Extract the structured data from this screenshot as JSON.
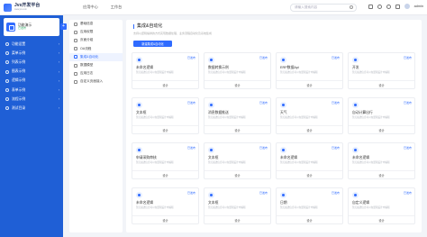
{
  "header": {
    "logo_title": "Jvs开发平台",
    "logo_sub": "www.jvs.com",
    "nav": [
      "应用中心",
      "工作台"
    ],
    "search_placeholder": "请输入搜索内容",
    "user": "admin"
  },
  "sidebar": {
    "app": {
      "name": "功能演示",
      "tag": "已发布"
    },
    "add_label": "+",
    "items": [
      {
        "label": "功能设置"
      },
      {
        "label": "菜单示例"
      },
      {
        "label": "列表示例"
      },
      {
        "label": "图表示例"
      },
      {
        "label": "逻辑示例"
      },
      {
        "label": "表单示例"
      },
      {
        "label": "流程示例"
      },
      {
        "label": "测试目录"
      }
    ]
  },
  "subnav": {
    "items": [
      {
        "label": "基础信息",
        "active": false
      },
      {
        "label": "应用权限",
        "active": false
      },
      {
        "label": "页面分组",
        "active": false
      },
      {
        "label": "OA流程",
        "active": false
      },
      {
        "label": "集成&自动化",
        "active": true
      },
      {
        "label": "数据模型",
        "active": false
      },
      {
        "label": "应用日志",
        "active": false
      },
      {
        "label": "自定义页面接入",
        "active": false
      }
    ]
  },
  "main": {
    "title": "集成&自动化",
    "desc": "支持以逻辑编排的方式实现数据处理、业务流程自动化及系统集成",
    "new_button": "新建集成&自动化",
    "cards": [
      {
        "name": "未命名逻辑",
        "badge": "已发布",
        "desc": "暂无描述信息可以在逻辑设计中编辑",
        "action": "设计"
      },
      {
        "name": "数据转换示例",
        "badge": "已发布",
        "desc": "暂无描述信息可以在逻辑设计中编辑",
        "action": "设计"
      },
      {
        "name": "ERP数据Api",
        "badge": "已发布",
        "desc": "暂无描述信息可以在逻辑设计中编辑",
        "action": "设计"
      },
      {
        "name": "开发",
        "badge": "已发布",
        "desc": "暂无描述信息可以在逻辑设计中编辑",
        "action": "设计"
      },
      {
        "name": "文本框",
        "badge": "已发布",
        "desc": "暂无描述信息可以在逻辑设计中编辑",
        "action": "设计"
      },
      {
        "name": "消息数据推送",
        "badge": "已发布",
        "desc": "暂无描述信息可以在逻辑设计中编辑",
        "action": "设计"
      },
      {
        "name": "天气",
        "badge": "已发布",
        "desc": "暂无描述信息可以在逻辑设计中编辑",
        "action": "设计"
      },
      {
        "name": "自动计算出行",
        "badge": "已发布",
        "desc": "暂无描述信息可以在逻辑设计中编辑",
        "action": "设计"
      },
      {
        "name": "申请采购审核",
        "badge": "已发布",
        "desc": "暂无描述信息可以在逻辑设计中编辑",
        "action": "设计"
      },
      {
        "name": "文本框",
        "badge": "已发布",
        "desc": "暂无描述信息可以在逻辑设计中编辑",
        "action": "设计"
      },
      {
        "name": "未命名逻辑",
        "badge": "已发布",
        "desc": "暂无描述信息可以在逻辑设计中编辑",
        "action": "设计"
      },
      {
        "name": "未命名逻辑",
        "badge": "已发布",
        "desc": "暂无描述信息可以在逻辑设计中编辑",
        "action": "设计"
      },
      {
        "name": "未命名逻辑",
        "badge": "已发布",
        "desc": "暂无描述信息可以在逻辑设计中编辑",
        "action": "设计"
      },
      {
        "name": "文本框",
        "badge": "已发布",
        "desc": "暂无描述信息可以在逻辑设计中编辑",
        "action": "设计"
      },
      {
        "name": "日期",
        "badge": "已发布",
        "desc": "暂无描述信息可以在逻辑设计中编辑",
        "action": "设计"
      },
      {
        "name": "自定义逻辑",
        "badge": "已发布",
        "desc": "暂无描述信息可以在逻辑设计中编辑",
        "action": "设计"
      }
    ]
  }
}
